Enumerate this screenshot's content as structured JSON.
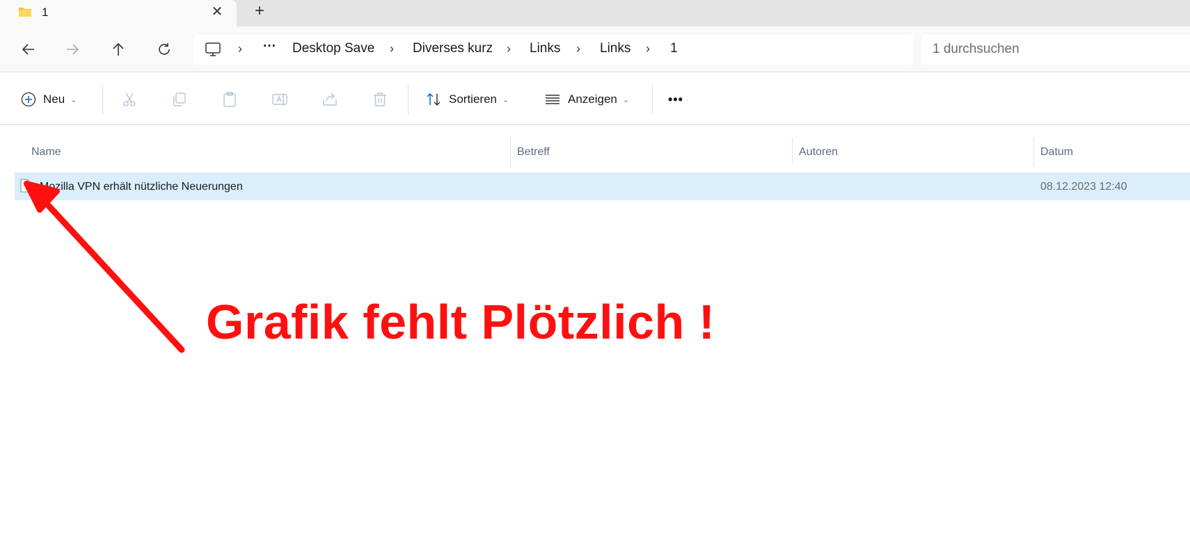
{
  "window": {
    "tab_title": "1",
    "close_glyph": "✕",
    "new_tab_glyph": "+"
  },
  "navigation": {
    "back": "arrow-left-icon",
    "forward": "arrow-right-icon",
    "up": "arrow-up-icon",
    "refresh": "refresh-icon"
  },
  "address": {
    "overflow": "···",
    "segments": [
      "Desktop Save",
      "Diverses kurz",
      "Links",
      "Links",
      "1"
    ],
    "separator": "›"
  },
  "search": {
    "placeholder": "1 durchsuchen"
  },
  "commands": {
    "new_label": "Neu",
    "sort_label": "Sortieren",
    "view_label": "Anzeigen",
    "more": "•••"
  },
  "columns": [
    "Name",
    "Betreff",
    "Autoren",
    "Datum"
  ],
  "files": [
    {
      "name": "Mozilla VPN erhält nützliche Neuerungen",
      "subject": "",
      "authors": "",
      "date": "08.12.2023 12:40"
    }
  ],
  "annotation": {
    "text": "Grafik fehlt Plötzlich !",
    "color": "#ff1010"
  },
  "colors": {
    "selection": "#dbeefc",
    "accent": "#0067c0"
  }
}
